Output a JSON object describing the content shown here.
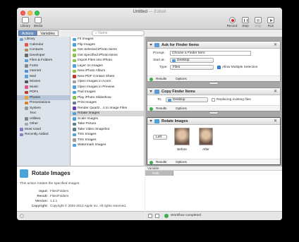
{
  "window": {
    "title": "Untitled",
    "edited": "— Edited"
  },
  "toolbar": {
    "library": "Library",
    "media": "Media",
    "record": "Record",
    "step": "Step",
    "stop": "Stop",
    "run": "Run"
  },
  "tabs": {
    "actions": "Actions",
    "variables": "Variables"
  },
  "search": {
    "placeholder": "Name"
  },
  "library": [
    {
      "label": "Library",
      "color": "#7a9fd0",
      "top": true
    },
    {
      "label": "Calendar",
      "color": "#e05a4a"
    },
    {
      "label": "Contacts",
      "color": "#b08a5a"
    },
    {
      "label": "Developer",
      "color": "#6a6a6a"
    },
    {
      "label": "Files & Folders",
      "color": "#5b9bd5"
    },
    {
      "label": "Fonts",
      "color": "#888888"
    },
    {
      "label": "Internet",
      "color": "#4a90d9"
    },
    {
      "label": "Mail",
      "color": "#5aa0e0"
    },
    {
      "label": "Movies",
      "color": "#555555"
    },
    {
      "label": "Music",
      "color": "#e0558a"
    },
    {
      "label": "PDFs",
      "color": "#c0392b"
    },
    {
      "label": "Photos",
      "color": "#e8a23a",
      "selected": true
    },
    {
      "label": "Presentations",
      "color": "#d9822b"
    },
    {
      "label": "System",
      "color": "#999999"
    },
    {
      "label": "Text",
      "color": "#dddddd"
    },
    {
      "label": "Utilities",
      "color": "#7f8c8d"
    },
    {
      "label": "Other",
      "color": "#aaaaaa"
    },
    {
      "label": "Most Used",
      "color": "#8e7cc3",
      "top": true
    },
    {
      "label": "Recently Added",
      "color": "#8e7cc3",
      "top": true
    }
  ],
  "actions": [
    {
      "label": "Fit Images",
      "color": "#4aa3d9"
    },
    {
      "label": "Flip Images",
      "color": "#4aa3d9"
    },
    {
      "label": "Get Selected iPhoto Items",
      "color": "#8bc34a"
    },
    {
      "label": "Get Specified iPhoto Items",
      "color": "#8bc34a"
    },
    {
      "label": "Import Files into iPhoto",
      "color": "#8bc34a"
    },
    {
      "label": "Layer on Images",
      "color": "#4aa3d9"
    },
    {
      "label": "New iPhoto Album",
      "color": "#8bc34a"
    },
    {
      "label": "New PDF Contact Sheet",
      "color": "#c0392b"
    },
    {
      "label": "Open Images in Acorn",
      "color": "#9e9e9e"
    },
    {
      "label": "Open Images in Preview",
      "color": "#4aa3d9"
    },
    {
      "label": "Pad Images",
      "color": "#4aa3d9"
    },
    {
      "label": "Play iPhoto Slideshow",
      "color": "#8bc34a"
    },
    {
      "label": "Print Images",
      "color": "#607d8b"
    },
    {
      "label": "Render Quartz…s to Image Files",
      "color": "#673ab7"
    },
    {
      "label": "Rotate Images",
      "color": "#4aa3d9",
      "selected": true
    },
    {
      "label": "Scale Images",
      "color": "#4aa3d9"
    },
    {
      "label": "Take Picture",
      "color": "#607d8b"
    },
    {
      "label": "Take Video Snapshot",
      "color": "#607d8b"
    },
    {
      "label": "Trim Images",
      "color": "#4aa3d9"
    },
    {
      "label": "Trim Images",
      "color": "#9e9e9e"
    },
    {
      "label": "Watermark Images",
      "color": "#4aa3d9"
    }
  ],
  "description": {
    "title": "Rotate Images",
    "text": "This action rotates the specified images.",
    "input_key": "Input:",
    "input_val": "Files/Folders",
    "result_key": "Result:",
    "result_val": "Files/Folders",
    "version_key": "Version:",
    "version_val": "1.2.1",
    "copyright_key": "Copyright:",
    "copyright_val": "Copyright © 2004-2012 Apple Inc.  All rights reserved."
  },
  "workflow": {
    "ask": {
      "title": "Ask for Finder Items",
      "prompt_label": "Prompt:",
      "prompt_value": "Choose a Finder Item:",
      "start_label": "Start at:",
      "start_value": "Desktop",
      "type_label": "Type:",
      "type_value": "Files",
      "multi_label": "Allow Multiple Selection",
      "results": "Results",
      "options": "Options"
    },
    "copy": {
      "title": "Copy Finder Items",
      "to_label": "To:",
      "to_value": "Desktop",
      "replace_label": "Replacing existing files",
      "results": "Results",
      "options": "Options"
    },
    "rotate": {
      "title": "Rotate Images",
      "direction": "Left",
      "before": "Before",
      "after": "After",
      "results": "Results",
      "options": "Options"
    }
  },
  "variables": {
    "header": "Variable",
    "column": "Path"
  },
  "status": {
    "text": "Workflow completed"
  }
}
